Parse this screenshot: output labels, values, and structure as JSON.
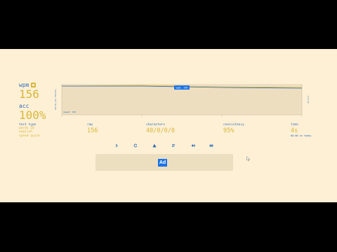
{
  "results": {
    "wpm_label": "wpm",
    "wpm_value": "156",
    "acc_label": "acc",
    "acc_value": "100%"
  },
  "test_info": {
    "type_label": "test type",
    "lines": [
      "words 10",
      "english",
      "speed quick"
    ]
  },
  "stats": [
    {
      "label": "raw",
      "value": "156"
    },
    {
      "label": "characters",
      "value": "40/0/0/0"
    },
    {
      "label": "consistency",
      "value": "95%"
    },
    {
      "label": "time",
      "value": "4s",
      "note": "00:00 on today"
    }
  ],
  "chart": {
    "y_axis_label": "Words per Minute",
    "y2_axis_label": "Errors",
    "tooltip": "wpm: 156",
    "inner_label": "speed: 156",
    "color_wpm": "#2b6bb8",
    "color_raw": "#d8b73a"
  },
  "actions": [
    {
      "name": "next-test-icon",
      "glyph": "›"
    },
    {
      "name": "restart-icon",
      "glyph": "↻"
    },
    {
      "name": "warning-icon",
      "glyph": "⚠"
    },
    {
      "name": "list-icon",
      "glyph": "≡"
    },
    {
      "name": "rewind-icon",
      "glyph": "⏮"
    },
    {
      "name": "image-icon",
      "glyph": "▬"
    }
  ],
  "ad": {
    "label": "Ad",
    "color": "#1a73e8"
  }
}
